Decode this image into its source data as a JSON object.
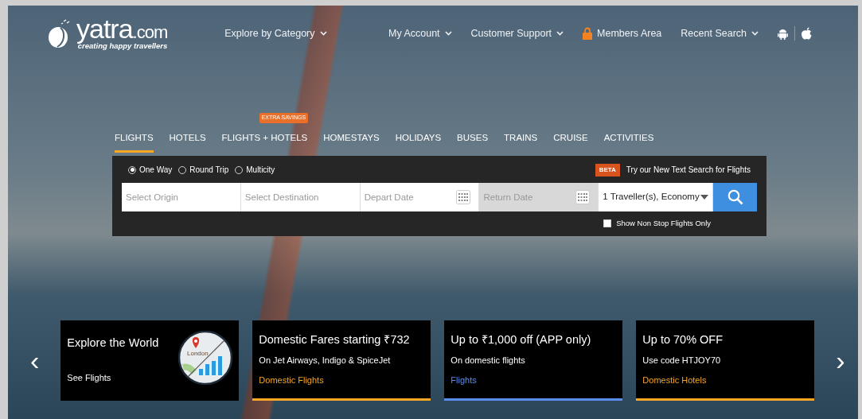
{
  "logo": {
    "name": "yatra",
    "suffix": ".com",
    "tagline": "creating happy travellers"
  },
  "nav_left": [
    {
      "label": "Explore by Category",
      "kind": "dropdown"
    }
  ],
  "nav_right": [
    {
      "label": "My Account",
      "kind": "dropdown"
    },
    {
      "label": "Customer Support",
      "kind": "dropdown"
    },
    {
      "label": "Members Area",
      "kind": "lock"
    },
    {
      "label": "Recent Search",
      "kind": "dropdown"
    }
  ],
  "tabs": [
    {
      "label": "FLIGHTS",
      "selected": true
    },
    {
      "label": "HOTELS",
      "selected": false
    },
    {
      "label": "FLIGHTS + HOTELS",
      "selected": false,
      "badge": "EXTRA SAVINGS"
    },
    {
      "label": "HOMESTAYS",
      "selected": false
    },
    {
      "label": "HOLIDAYS",
      "selected": false
    },
    {
      "label": "BUSES",
      "selected": false
    },
    {
      "label": "TRAINS",
      "selected": false
    },
    {
      "label": "CRUISE",
      "selected": false
    },
    {
      "label": "ACTIVITIES",
      "selected": false
    }
  ],
  "trip_types": [
    {
      "label": "One Way",
      "selected": true
    },
    {
      "label": "Round Trip",
      "selected": false
    },
    {
      "label": "Multicity",
      "selected": false
    }
  ],
  "beta": {
    "badge": "BETA",
    "text": "Try our New Text Search for Flights"
  },
  "fields": [
    {
      "kind": "text",
      "placeholder": "Select Origin",
      "disabled": false
    },
    {
      "kind": "text",
      "placeholder": "Select Destination",
      "disabled": false
    },
    {
      "kind": "date",
      "placeholder": "Depart Date",
      "disabled": false
    },
    {
      "kind": "date",
      "placeholder": "Return Date",
      "disabled": true
    },
    {
      "kind": "select",
      "value": "1 Traveller(s), Economy",
      "disabled": false
    }
  ],
  "nonstop": {
    "label": "Show Non Stop Flights Only",
    "checked": false
  },
  "carousel": {
    "prev": "‹",
    "next": "›"
  },
  "cards": [
    {
      "kind": "image",
      "title": "Explore the World",
      "link": "See Flights",
      "map_label": "London"
    },
    {
      "kind": "offer",
      "title": "Domestic Fares starting ₹732",
      "subtitle": "On Jet Airways, Indigo & SpiceJet",
      "link": "Domestic Flights",
      "color": "#f5a623"
    },
    {
      "kind": "offer",
      "title": "Up to ₹1,000 off (APP only)",
      "subtitle": "On domestic flights",
      "link": "Flights",
      "color": "#5b8def"
    },
    {
      "kind": "offer",
      "title": "Up to 70% OFF",
      "subtitle": "Use code HTJOY70",
      "link": "Domestic Hotels",
      "color": "#f5a623"
    }
  ]
}
